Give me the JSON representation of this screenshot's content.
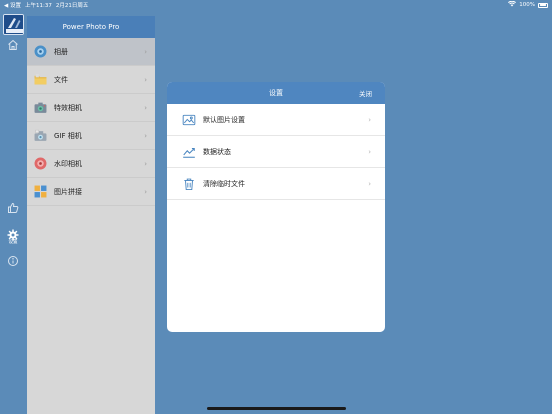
{
  "status_bar": {
    "back_label": "◀ 设置",
    "time": "上午11:37",
    "date": "2月21日周五",
    "battery": "100%"
  },
  "rail": {
    "settings_label": "设置"
  },
  "menu": {
    "title": "Power Photo Pro",
    "items": [
      {
        "label": "相册",
        "icon": "album-icon"
      },
      {
        "label": "文件",
        "icon": "folder-icon"
      },
      {
        "label": "特效相机",
        "icon": "effect-camera-icon"
      },
      {
        "label": "GIF 相机",
        "icon": "gif-camera-icon"
      },
      {
        "label": "水印相机",
        "icon": "watermark-camera-icon"
      },
      {
        "label": "图片拼接",
        "icon": "collage-icon"
      }
    ],
    "chevron": "›"
  },
  "dialog": {
    "title": "设置",
    "close_label": "关闭",
    "rows": [
      {
        "label": "默认图片设置",
        "icon": "image-icon"
      },
      {
        "label": "数据状态",
        "icon": "chart-icon"
      },
      {
        "label": "清除临时文件",
        "icon": "trash-icon"
      }
    ],
    "chevron": "›"
  },
  "colors": {
    "background": "#5b8bb8",
    "accent": "#4f86c0",
    "menu_bg": "#d7d7d7",
    "selected_bg": "#bfc3c9"
  }
}
